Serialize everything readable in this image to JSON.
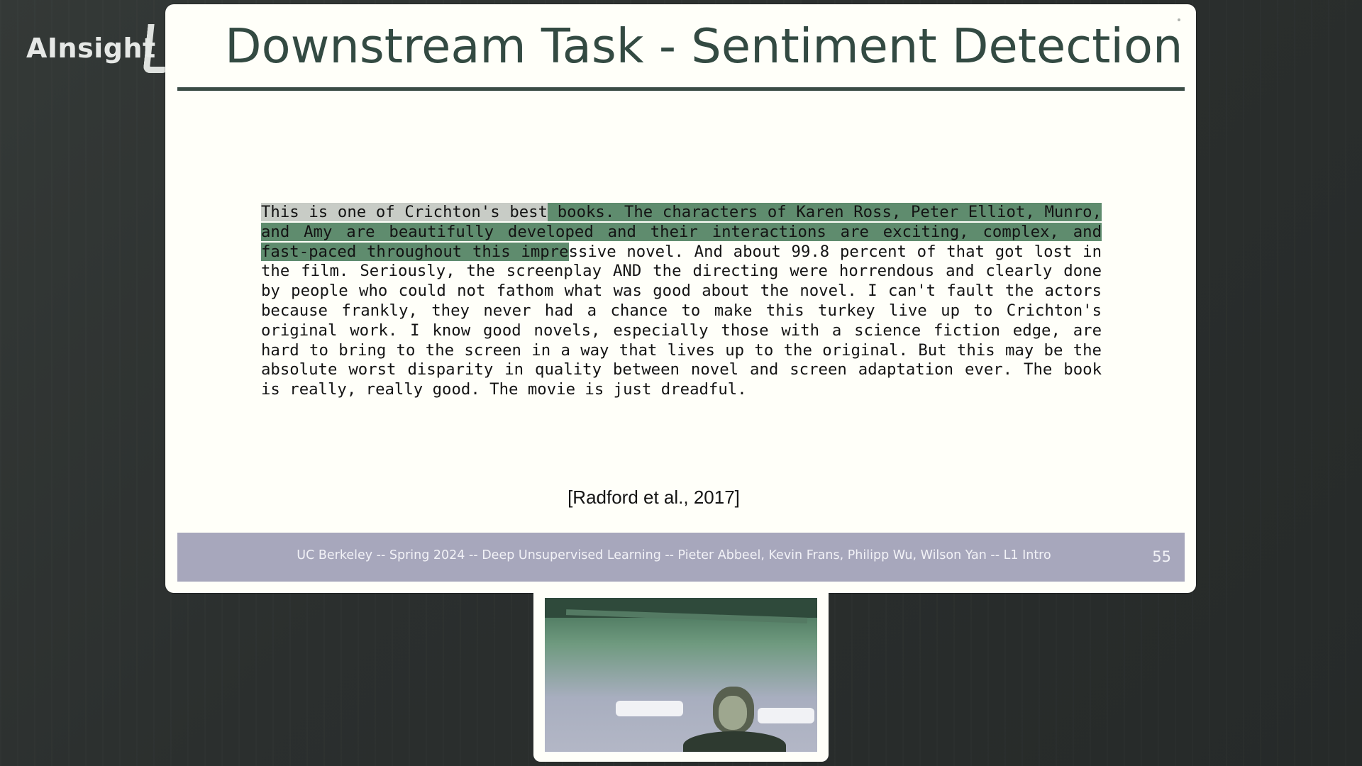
{
  "brand": {
    "name": "AInsight"
  },
  "slide": {
    "title": "Downstream Task - Sentiment Detection",
    "passage": {
      "highlight_neutral": "This is one of Crichton's best",
      "highlight_positive": " books. The characters of Karen Ross, Peter Elliot, Munro, and Amy are beautifully developed and their interactions are exciting, complex, and fast-paced throughout this impre",
      "plain": "ssive novel. And about 99.8 percent of that got lost in the film. Seriously, the screenplay AND the directing were horrendous and clearly done by people who could not fathom what was good about the novel. I can't fault the actors because frankly, they never had a chance to make this turkey live up to Crichton's original work. I know good novels, especially those with a science fiction edge, are hard to bring to the screen in a way that lives up to the original. But this may be the absolute worst disparity in quality between novel and screen adaptation ever. The book is really, really good. The movie is just dreadful."
    },
    "citation": "[Radford et al., 2017]",
    "footer": "UC Berkeley -- Spring 2024 -- Deep Unsupervised Learning -- Pieter Abbeel, Kevin Frans, Philipp Wu, Wilson Yan -- L1 Intro",
    "page_number": "55"
  },
  "colors": {
    "title": "#334a42",
    "positive_highlight": "#5f8c6e",
    "footer_bar": "#a7a7bc",
    "slide_background": "#fffff9",
    "app_background": "#2d3130"
  },
  "webcam": {
    "icon": "presenter-video-feed"
  }
}
